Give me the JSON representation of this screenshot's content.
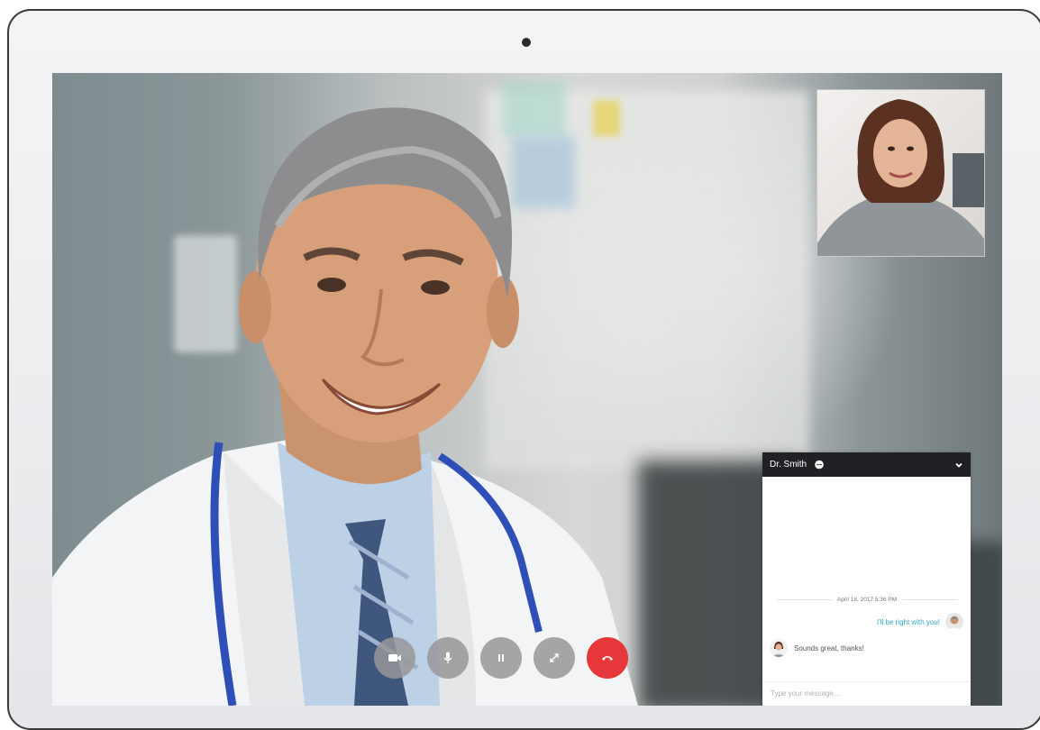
{
  "chat": {
    "contact_name": "Dr. Smith",
    "timestamp": "April 18, 2017 5:36 PM",
    "messages": [
      {
        "direction": "outgoing",
        "text": "I'll be right with you!"
      },
      {
        "direction": "incoming",
        "text": "Sounds great, thanks!"
      }
    ],
    "input_placeholder": "Type your message..."
  },
  "controls": [
    {
      "name": "video",
      "icon": "video-camera-icon"
    },
    {
      "name": "microphone",
      "icon": "microphone-icon"
    },
    {
      "name": "pause",
      "icon": "pause-icon"
    },
    {
      "name": "fullscreen",
      "icon": "expand-icon"
    },
    {
      "name": "end-call",
      "icon": "hang-up-icon",
      "color": "#e6373a"
    }
  ],
  "colors": {
    "chat_header": "#1f2124",
    "outgoing_text": "#2fa8c8",
    "end_call": "#e6373a"
  }
}
